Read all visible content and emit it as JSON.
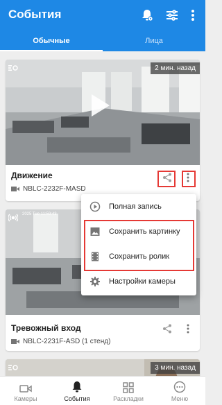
{
  "appbar": {
    "title": "События"
  },
  "tabs": [
    {
      "label": "Обычные"
    },
    {
      "label": "Лица"
    }
  ],
  "cards": [
    {
      "time": "2 мин. назад",
      "title": "Движение",
      "camera": "NBLC-2232F-MASD"
    },
    {
      "timestamp": "2025 Tue 11:59:43",
      "title": "Тревожный вход",
      "camera": "NBLC-2231F-ASD (1 стенд)"
    },
    {
      "time": "3 мин. назад"
    }
  ],
  "menu": {
    "items": [
      {
        "label": "Полная запись",
        "icon": "play-circle-icon"
      },
      {
        "label": "Сохранить картинку",
        "icon": "image-icon"
      },
      {
        "label": "Сохранить ролик",
        "icon": "film-icon"
      },
      {
        "label": "Настройки камеры",
        "icon": "gear-icon"
      }
    ]
  },
  "bottom_nav": [
    {
      "label": "Камеры",
      "icon": "camera-icon"
    },
    {
      "label": "События",
      "icon": "bell-icon"
    },
    {
      "label": "Раскладки",
      "icon": "grid-icon"
    },
    {
      "label": "Меню",
      "icon": "more-icon"
    }
  ],
  "colors": {
    "primary": "#1e88e5",
    "highlight": "#e53935"
  }
}
